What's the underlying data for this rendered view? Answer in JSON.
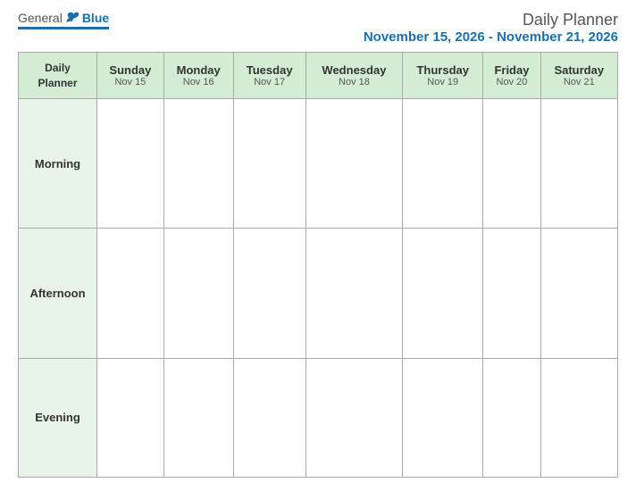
{
  "header": {
    "logo": {
      "general": "General",
      "blue": "Blue"
    },
    "title": "Daily Planner",
    "date_range": "November 15, 2026 - November 21, 2026"
  },
  "table": {
    "label_header_line1": "Daily",
    "label_header_line2": "Planner",
    "columns": [
      {
        "day": "Sunday",
        "date": "Nov 15"
      },
      {
        "day": "Monday",
        "date": "Nov 16"
      },
      {
        "day": "Tuesday",
        "date": "Nov 17"
      },
      {
        "day": "Wednesday",
        "date": "Nov 18"
      },
      {
        "day": "Thursday",
        "date": "Nov 19"
      },
      {
        "day": "Friday",
        "date": "Nov 20"
      },
      {
        "day": "Saturday",
        "date": "Nov 21"
      }
    ],
    "rows": [
      {
        "label": "Morning"
      },
      {
        "label": "Afternoon"
      },
      {
        "label": "Evening"
      }
    ]
  }
}
